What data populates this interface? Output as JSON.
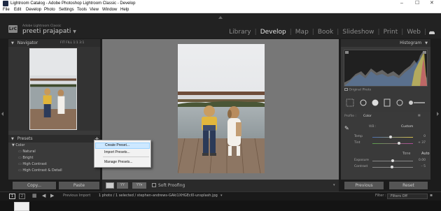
{
  "window": {
    "title": "Lightroom Catalog - Adobe Photoshop Lightroom Classic - Develop",
    "controls": {
      "minimize": "–",
      "maximize": "☐",
      "close": "✕"
    }
  },
  "menubar": [
    "File",
    "Edit",
    "Develop",
    "Photo",
    "Settings",
    "Tools",
    "View",
    "Window",
    "Help"
  ],
  "header": {
    "logo": "LrC",
    "product": "Adobe Lightroom Classic",
    "user": "preeti prajapati",
    "user_caret": "▼",
    "modules": [
      "Library",
      "Develop",
      "Map",
      "Book",
      "Slideshow",
      "Print",
      "Web"
    ],
    "active_module": "Develop"
  },
  "navigator": {
    "title": "Navigator",
    "view_options": "FIT  FILL  1:1  3:1"
  },
  "presets": {
    "title": "Presets",
    "add": "+",
    "items": [
      {
        "label": "▼  Color",
        "indent": 0
      },
      {
        "label": "Natural",
        "indent": 1
      },
      {
        "label": "Bright",
        "indent": 1
      },
      {
        "label": "High Contrast",
        "indent": 1
      },
      {
        "label": "High Contrast & Detail",
        "indent": 1
      }
    ]
  },
  "left_buttons": {
    "copy": "Copy...",
    "paste": "Paste"
  },
  "context_menu": {
    "items": [
      "Create Preset...",
      "Import Presets...",
      "Manage Presets..."
    ],
    "highlighted_index": 0
  },
  "toolbar": {
    "soft_proofing": "Soft Proofing"
  },
  "right_panel": {
    "histogram_title": "Histogram",
    "original_photo": "Original Photo",
    "profile_label": "Profile :",
    "profile_value": "Color",
    "wb_label": "WB :",
    "wb_value": "Custom",
    "temp_label": "Temp",
    "temp_value": "0",
    "tint_label": "Tint",
    "tint_value": "+ 37",
    "tone_label": "Tone",
    "tone_auto": "Auto",
    "exposure_label": "Exposure",
    "exposure_value": "0.00",
    "contrast_label": "Contrast",
    "contrast_value": "– 5"
  },
  "right_buttons": {
    "previous": "Previous",
    "reset": "Reset"
  },
  "filmstrip": {
    "page1": "1",
    "page2": "2",
    "previous_import": "Previous Import",
    "info": "1 photo / 1 selected / stephen-andrews-GAki1XHGEcI0-unsplash.jpg",
    "filter_label": "Filter :",
    "filter_value": "Filters Off"
  },
  "colors": {
    "accent_selection": "#cde8ff",
    "panel": "#3a3a3a",
    "background": "#777777"
  }
}
